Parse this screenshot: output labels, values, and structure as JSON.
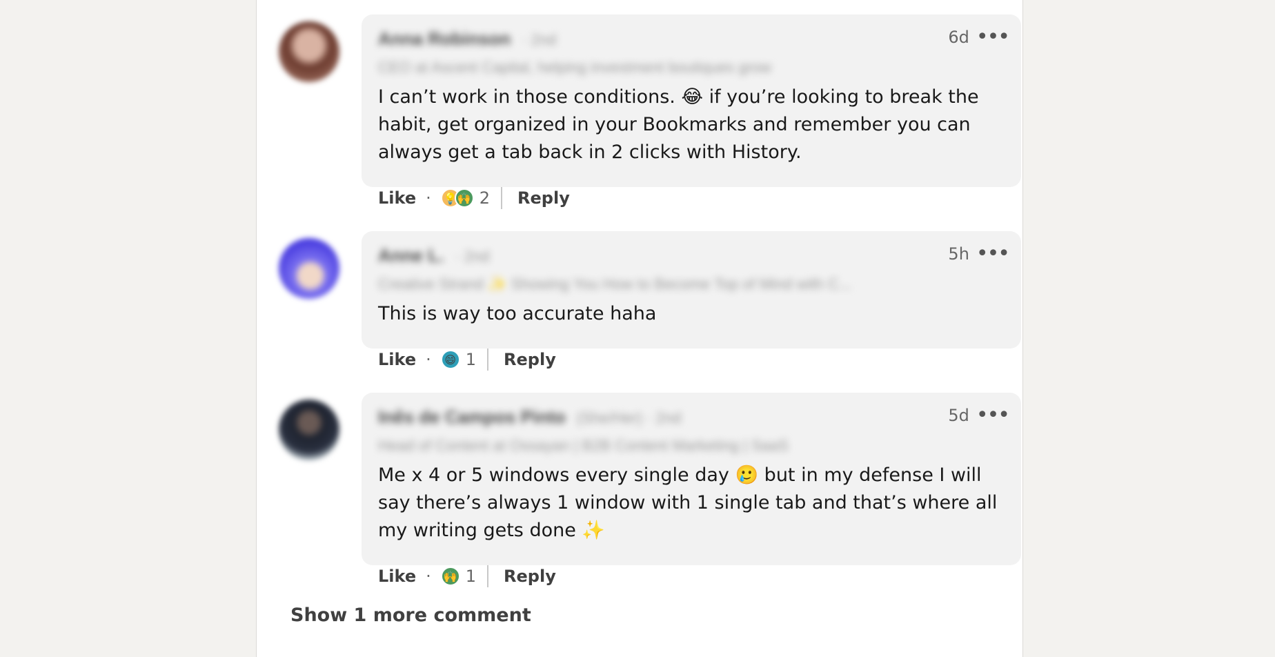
{
  "comments": [
    {
      "author": "Anna Robinson",
      "degree": "· 2nd",
      "headline": "CEO at Ascent Capital, helping investment boutiques grow",
      "time": "6d",
      "text": "I can’t work in those conditions. 😂 if you’re looking to break the habit, get organized in your Bookmarks and remember you can always get a tab back in 2 clicks with History.",
      "like_label": "Like",
      "reactions": [
        "insightful-icon",
        "support-icon"
      ],
      "reaction_count": "2",
      "reply_label": "Reply"
    },
    {
      "author": "Anne L.",
      "degree": "· 2nd",
      "headline": "Creative Strand ✨ Showing You How to Become Top of Mind with C...",
      "time": "5h",
      "text": "This is way too accurate haha",
      "like_label": "Like",
      "reactions": [
        "funny-icon"
      ],
      "reaction_count": "1",
      "reply_label": "Reply"
    },
    {
      "author": "Inês de Campos Pinto",
      "degree": "(She/Her) · 2nd",
      "headline": "Head of Content at Ossayan | B2B Content Marketing | SaaS",
      "time": "5d",
      "text": "Me x 4 or 5 windows every single day 🥲 but in my defense I will say there’s always 1 window with 1 single tab and that’s where all my writing gets done ✨",
      "like_label": "Like",
      "reactions": [
        "support-icon"
      ],
      "reaction_count": "1",
      "reply_label": "Reply"
    }
  ],
  "show_more_label": "Show 1 more comment",
  "colors": {
    "page_bg": "#f3f2ef",
    "bubble_bg": "#f2f2f2",
    "text": "#191919",
    "muted": "#666666"
  }
}
